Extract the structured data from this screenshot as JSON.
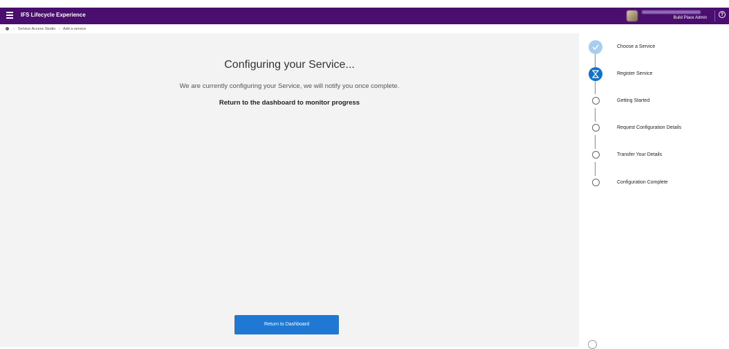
{
  "header": {
    "app_title": "IFS Lifecycle Experience",
    "user_role": "Build Place Admin",
    "help_symbol": "?"
  },
  "breadcrumb": {
    "items": [
      "Service Access Studio",
      "Add a service"
    ],
    "separator": "›"
  },
  "main": {
    "title": "Configuring your Service...",
    "subtitle": "We are currently configuring your Service, we will notify you once complete.",
    "link_text": "Return to the dashboard to monitor progress",
    "button_label": "Return to Dashboard"
  },
  "steps": [
    {
      "label": "Choose a Service",
      "state": "done"
    },
    {
      "label": "Register Service",
      "state": "active"
    },
    {
      "label": "Getting Started",
      "state": "todo"
    },
    {
      "label": "Request Configuration Details",
      "state": "todo"
    },
    {
      "label": "Transfer Your Details",
      "state": "todo"
    },
    {
      "label": "Configuration Complete",
      "state": "todo"
    }
  ],
  "colors": {
    "header_bg": "#4a0f6e",
    "accent": "#1f79d4",
    "step_done": "#a8cdee",
    "step_active": "#1272c8"
  },
  "icons": {
    "menu": "hamburger-icon",
    "help": "help-icon",
    "home": "home-icon",
    "step_done": "check-icon",
    "step_active": "hourglass-icon",
    "chat": "chat-icon"
  }
}
